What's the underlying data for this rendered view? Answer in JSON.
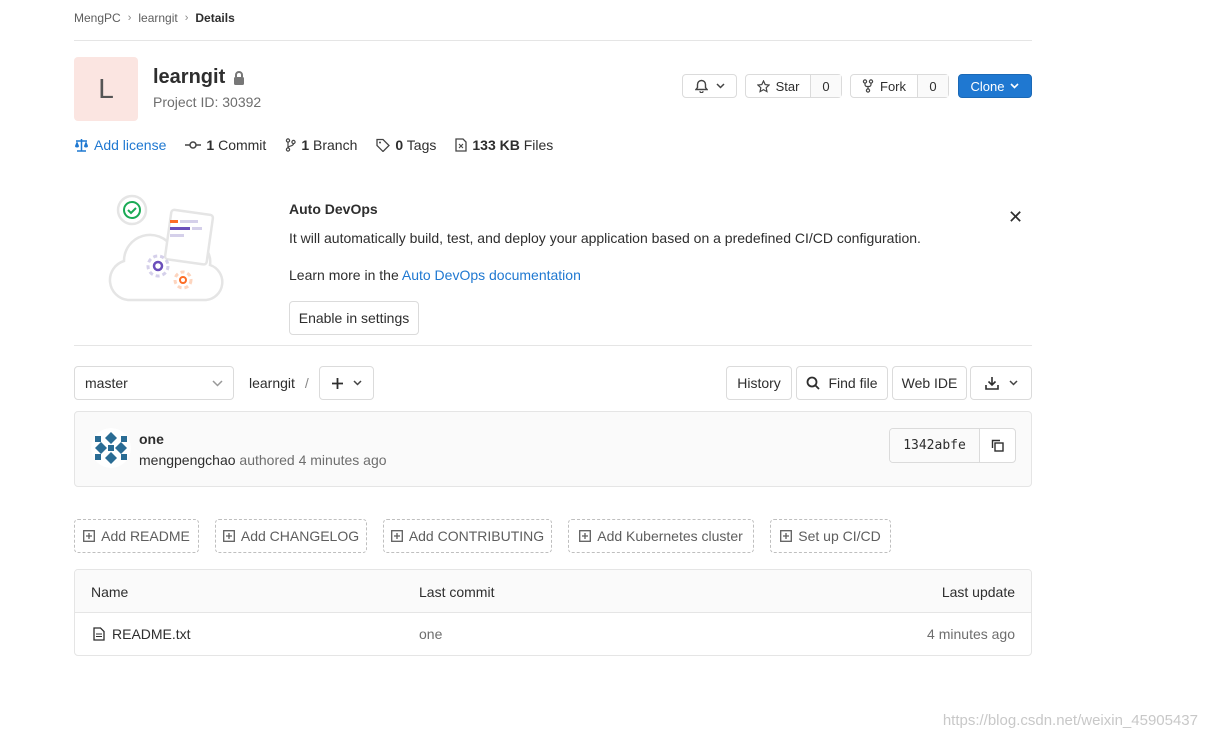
{
  "breadcrumb": {
    "group": "MengPC",
    "project": "learngit",
    "current": "Details"
  },
  "project": {
    "avatar_letter": "L",
    "name": "learngit",
    "id_label": "Project ID: 30392"
  },
  "actions": {
    "star_label": "Star",
    "star_count": "0",
    "fork_label": "Fork",
    "fork_count": "0",
    "clone_label": "Clone"
  },
  "stats": {
    "add_license": "Add license",
    "commits_count": "1",
    "commits_label": "Commit",
    "branches_count": "1",
    "branches_label": "Branch",
    "tags_count": "0",
    "tags_label": "Tags",
    "files_size": "133 KB",
    "files_label": "Files"
  },
  "devops": {
    "title": "Auto DevOps",
    "description": "It will automatically build, test, and deploy your application based on a predefined CI/CD configuration.",
    "learn_prefix": "Learn more in the",
    "learn_link": "Auto DevOps documentation",
    "enable_button": "Enable in settings"
  },
  "tree": {
    "branch": "master",
    "path_root": "learngit",
    "path_sep": "/",
    "history": "History",
    "find_file": "Find file",
    "web_ide": "Web IDE"
  },
  "last_commit": {
    "title": "one",
    "author": "mengpengchao",
    "authored_text": "authored 4 minutes ago",
    "sha": "1342abfe"
  },
  "quick_actions": [
    "Add README",
    "Add CHANGELOG",
    "Add CONTRIBUTING",
    "Add Kubernetes cluster",
    "Set up CI/CD"
  ],
  "files_table": {
    "headers": {
      "name": "Name",
      "last_commit": "Last commit",
      "last_update": "Last update"
    },
    "rows": [
      {
        "name": "README.txt",
        "last_commit": "one",
        "last_update": "4 minutes ago"
      }
    ]
  },
  "watermark": "https://blog.csdn.net/weixin_45905437",
  "colors": {
    "link": "#1f78d1",
    "clone_bg": "#1f78d1",
    "avatar_bg": "#fbe5e1"
  }
}
